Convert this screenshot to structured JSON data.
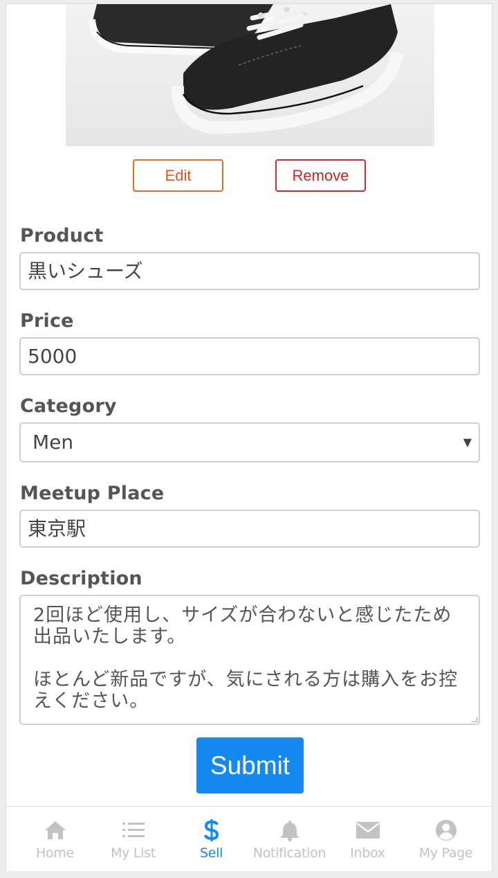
{
  "photo": {
    "alt": "black canvas sneakers"
  },
  "photo_actions": {
    "edit_label": "Edit",
    "remove_label": "Remove"
  },
  "form": {
    "product": {
      "label": "Product",
      "value": "黒いシューズ"
    },
    "price": {
      "label": "Price",
      "value": "5000"
    },
    "category": {
      "label": "Category",
      "value": "Men"
    },
    "meetup_place": {
      "label": "Meetup Place",
      "value": "東京駅"
    },
    "description": {
      "label": "Description",
      "value": "2回ほど使用し、サイズが合わないと感じたため出品いたします。\n\nほとんど新品ですが、気にされる方は購入をお控えください。"
    },
    "submit_label": "Submit"
  },
  "tabbar": {
    "active_color": "#1589f0",
    "inactive_color": "#c2c2c2",
    "items": [
      {
        "label": "Home",
        "icon": "home-icon"
      },
      {
        "label": "My List",
        "icon": "list-icon"
      },
      {
        "label": "Sell",
        "icon": "dollar-icon",
        "active": true
      },
      {
        "label": "Notification",
        "icon": "bell-icon"
      },
      {
        "label": "Inbox",
        "icon": "envelope-icon"
      },
      {
        "label": "My Page",
        "icon": "user-circle-icon"
      }
    ]
  },
  "colors": {
    "edit_accent": "#e0551b",
    "remove_accent": "#d21f1f",
    "submit_bg": "#1589f0"
  }
}
